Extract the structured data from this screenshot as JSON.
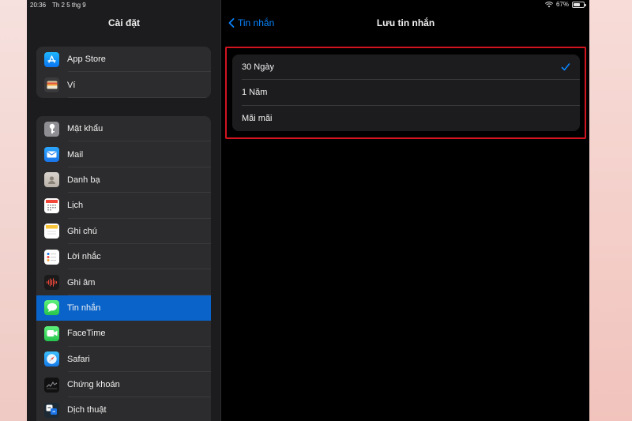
{
  "status": {
    "time": "20:36",
    "date": "Th 2 5 thg 9",
    "battery": "67%",
    "battery_level": 0.67
  },
  "sidebar": {
    "title": "Cài đặt",
    "group1": [
      {
        "label": "App Store",
        "icon": "app-store-icon"
      },
      {
        "label": "Ví",
        "icon": "wallet-icon"
      }
    ],
    "group2": [
      {
        "label": "Mật khẩu",
        "icon": "key-icon"
      },
      {
        "label": "Mail",
        "icon": "mail-icon"
      },
      {
        "label": "Danh bạ",
        "icon": "contacts-icon"
      },
      {
        "label": "Lịch",
        "icon": "calendar-icon"
      },
      {
        "label": "Ghi chú",
        "icon": "notes-icon"
      },
      {
        "label": "Lời nhắc",
        "icon": "reminders-icon"
      },
      {
        "label": "Ghi âm",
        "icon": "voice-memos-icon"
      },
      {
        "label": "Tin nhắn",
        "icon": "messages-icon",
        "selected": true
      },
      {
        "label": "FaceTime",
        "icon": "facetime-icon"
      },
      {
        "label": "Safari",
        "icon": "safari-icon"
      },
      {
        "label": "Chứng khoán",
        "icon": "stocks-icon"
      },
      {
        "label": "Dịch thuật",
        "icon": "translate-icon"
      }
    ]
  },
  "detail": {
    "back_label": "Tin nhắn",
    "title": "Lưu tin nhắn",
    "options": [
      {
        "label": "30 Ngày",
        "checked": true
      },
      {
        "label": "1 Năm",
        "checked": false
      },
      {
        "label": "Mãi mãi",
        "checked": false
      }
    ]
  },
  "colors": {
    "accent": "#0a84ff",
    "selected_row": "#0a63c9",
    "highlight_border": "#d2141f"
  }
}
